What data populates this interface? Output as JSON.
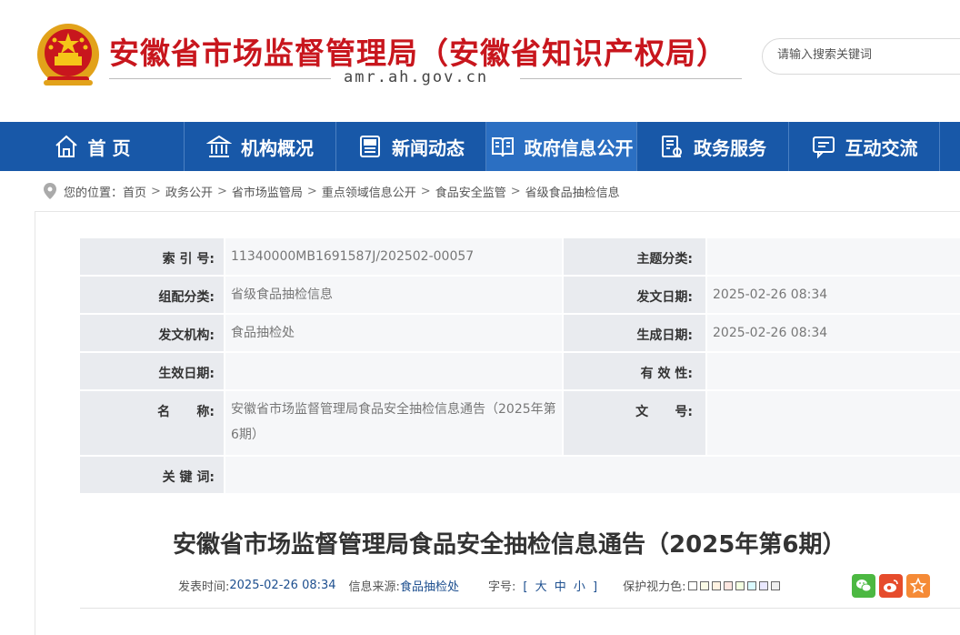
{
  "header": {
    "site_title": "安徽省市场监督管理局（安徽省知识产权局）",
    "site_domain": "amr.ah.gov.cn",
    "search_placeholder": "请输入搜索关键词"
  },
  "nav": {
    "items": [
      {
        "label": "首 页",
        "icon": "home-icon"
      },
      {
        "label": "机构概况",
        "icon": "institution-icon"
      },
      {
        "label": "新闻动态",
        "icon": "newspaper-icon"
      },
      {
        "label": "政府信息公开",
        "icon": "open-book-icon"
      },
      {
        "label": "政务服务",
        "icon": "service-document-icon"
      },
      {
        "label": "互动交流",
        "icon": "chat-bubble-icon"
      }
    ],
    "active_index": 3,
    "bar_color": "#1858a8",
    "active_color": "#2b6fc2"
  },
  "breadcrumb": {
    "prefix": "您的位置：",
    "items": [
      "首页",
      "政务公开",
      "省市场监管局",
      "重点领域信息公开",
      "食品安全监管",
      "省级食品抽检信息"
    ],
    "separator": ">"
  },
  "meta": {
    "index_no_label": "索 引 号:",
    "index_no": "11340000MB1691587J/202502-00057",
    "topic_label": "主题分类:",
    "topic": "",
    "group_label": "组配分类:",
    "group": "省级食品抽检信息",
    "issue_date_label": "发文日期:",
    "issue_date": "2025-02-26 08:34",
    "issuer_label": "发文机构:",
    "issuer": "食品抽检处",
    "created_date_label": "生成日期:",
    "created_date": "2025-02-26 08:34",
    "effective_date_label": "生效日期:",
    "effective_date": "",
    "validity_label": "有 效 性:",
    "validity": "",
    "name_label": "名      称:",
    "name": "安徽省市场监督管理局食品安全抽检信息通告（2025年第6期）",
    "doc_no_label": "文      号:",
    "doc_no": "",
    "keywords_label": "关 键 词:",
    "keywords": ""
  },
  "article": {
    "title": "安徽省市场监督管理局食品安全抽检信息通告（2025年第6期）",
    "publish_time_label": "发表时间:",
    "publish_time": "2025-02-26 08:34",
    "source_label": "信息来源:",
    "source": "食品抽检处",
    "font_size_label": "字号:",
    "font_size_open": "[",
    "font_large": "大",
    "font_medium": "中",
    "font_small": "小",
    "font_size_close": "]",
    "eye_care_label": "保护视力色:",
    "eye_care_colors": [
      "#ffffff",
      "#fafbe6",
      "#fff2e2",
      "#fde6e0",
      "#f3ffe1",
      "#dafaff",
      "#eae8ff",
      "#eeeeee"
    ],
    "share": [
      {
        "icon": "wechat-icon",
        "color": "#4cb842"
      },
      {
        "icon": "weibo-icon",
        "color": "#e64c2c"
      },
      {
        "icon": "favorite-star-icon",
        "color": "#f58a36"
      }
    ]
  }
}
